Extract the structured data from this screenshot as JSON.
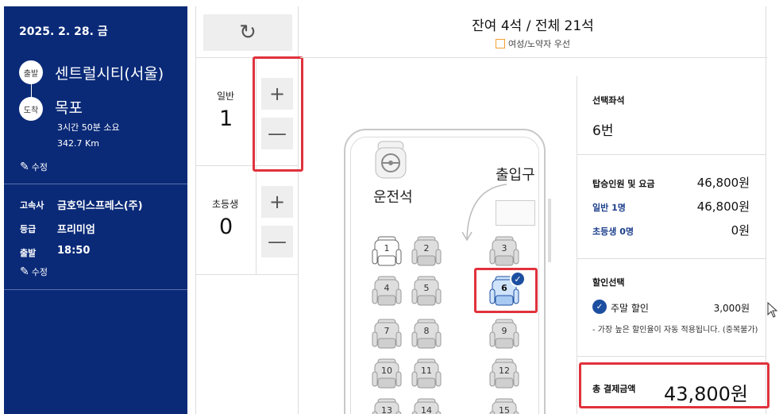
{
  "trip": {
    "date": "2025. 2. 28. 금",
    "depart_badge": "출발",
    "depart_city": "센트럴시티(서울)",
    "arrive_badge": "도착",
    "arrive_city": "목포",
    "duration": "3시간 50분 소요",
    "distance": "342.7 Km",
    "edit_label": "수정"
  },
  "info": {
    "company_key": "고속사",
    "company_val": "금호익스프레스(주)",
    "grade_key": "등급",
    "grade_val": "프리미엄",
    "depart_key": "출발",
    "depart_val": "18:50",
    "edit_label": "수정"
  },
  "counts": {
    "adult_label": "일반",
    "adult_count": "1",
    "child_label": "초등생",
    "child_count": "0",
    "plus": "+",
    "minus": "—",
    "refresh": "↻"
  },
  "header": {
    "title": "잔여 4석 / 전체 21석",
    "legend": "여성/노약자 우선"
  },
  "bus": {
    "driver_label": "운전석",
    "entrance_label": "출입구",
    "selected_check": "✓",
    "seats": [
      {
        "n": "1",
        "state": "available"
      },
      {
        "n": "2",
        "state": "taken"
      },
      {
        "n": "3",
        "state": "taken"
      },
      {
        "n": "4",
        "state": "taken"
      },
      {
        "n": "5",
        "state": "taken"
      },
      {
        "n": "6",
        "state": "selected"
      },
      {
        "n": "7",
        "state": "taken"
      },
      {
        "n": "8",
        "state": "taken"
      },
      {
        "n": "9",
        "state": "taken"
      },
      {
        "n": "10",
        "state": "taken"
      },
      {
        "n": "11",
        "state": "taken"
      },
      {
        "n": "12",
        "state": "taken"
      },
      {
        "n": "13",
        "state": "taken"
      },
      {
        "n": "14",
        "state": "taken"
      },
      {
        "n": "15",
        "state": "taken"
      }
    ]
  },
  "summary": {
    "selected_seat_label": "선택좌석",
    "selected_seat_value": "6번",
    "fare_label": "탑승인원 및 요금",
    "fare_total": "46,800원",
    "adult_row_label": "일반 1명",
    "adult_row_value": "46,800원",
    "child_row_label": "초등생 0명",
    "child_row_value": "0원",
    "discount_label": "할인선택",
    "discount_check": "✓",
    "discount_item": "주말 할인",
    "discount_amount": "3,000원",
    "discount_note": "- 가장 높은 할인율이 자동 적용됩니다. (중복불가)",
    "total_label": "총 결제금액",
    "total_amount": "43,800원"
  },
  "colors": {
    "panel_blue": "#0a2a78",
    "accent_blue": "#1d4fa0",
    "highlight_red": "#e0323c"
  }
}
